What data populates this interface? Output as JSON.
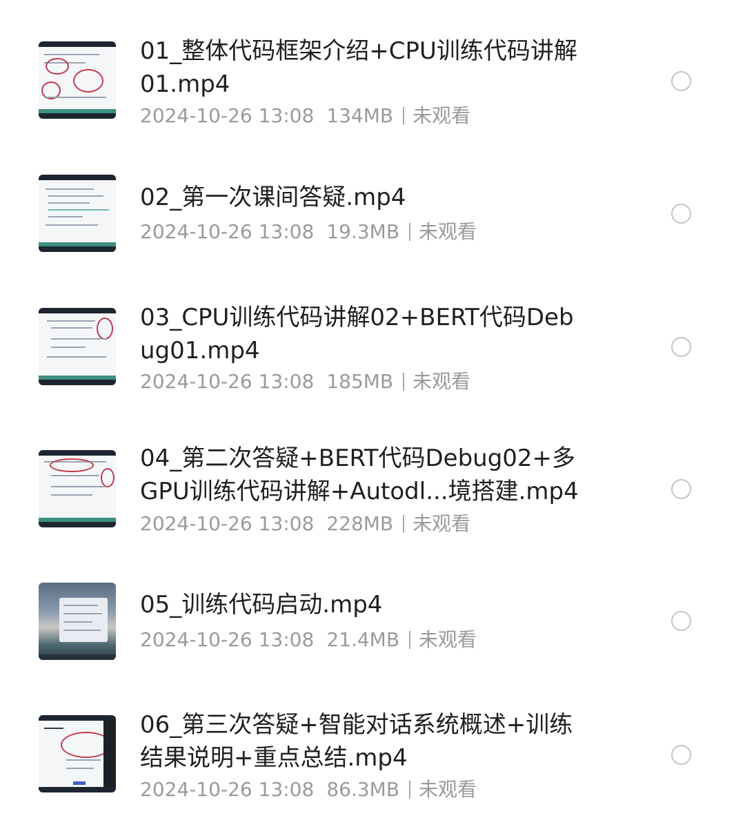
{
  "videos": [
    {
      "title": "01_整体代码框架介绍+CPU训练代码讲解\n01.mp4",
      "date": "2024-10-26 13:08",
      "size": "134MB",
      "status": "未观看"
    },
    {
      "title": "02_第一次课间答疑.mp4",
      "date": "2024-10-26 13:08",
      "size": "19.3MB",
      "status": "未观看"
    },
    {
      "title": "03_CPU训练代码讲解02+BERT代码Deb\nug01.mp4",
      "date": "2024-10-26 13:08",
      "size": "185MB",
      "status": "未观看"
    },
    {
      "title": "04_第二次答疑+BERT代码Debug02+多\nGPU训练代码讲解+Autodl...境搭建.mp4",
      "date": "2024-10-26 13:08",
      "size": "228MB",
      "status": "未观看"
    },
    {
      "title": "05_训练代码启动.mp4",
      "date": "2024-10-26 13:08",
      "size": "21.4MB",
      "status": "未观看"
    },
    {
      "title": "06_第三次答疑+智能对话系统概述+训练\n结果说明+重点总结.mp4",
      "date": "2024-10-26 13:08",
      "size": "86.3MB",
      "status": "未观看"
    }
  ]
}
